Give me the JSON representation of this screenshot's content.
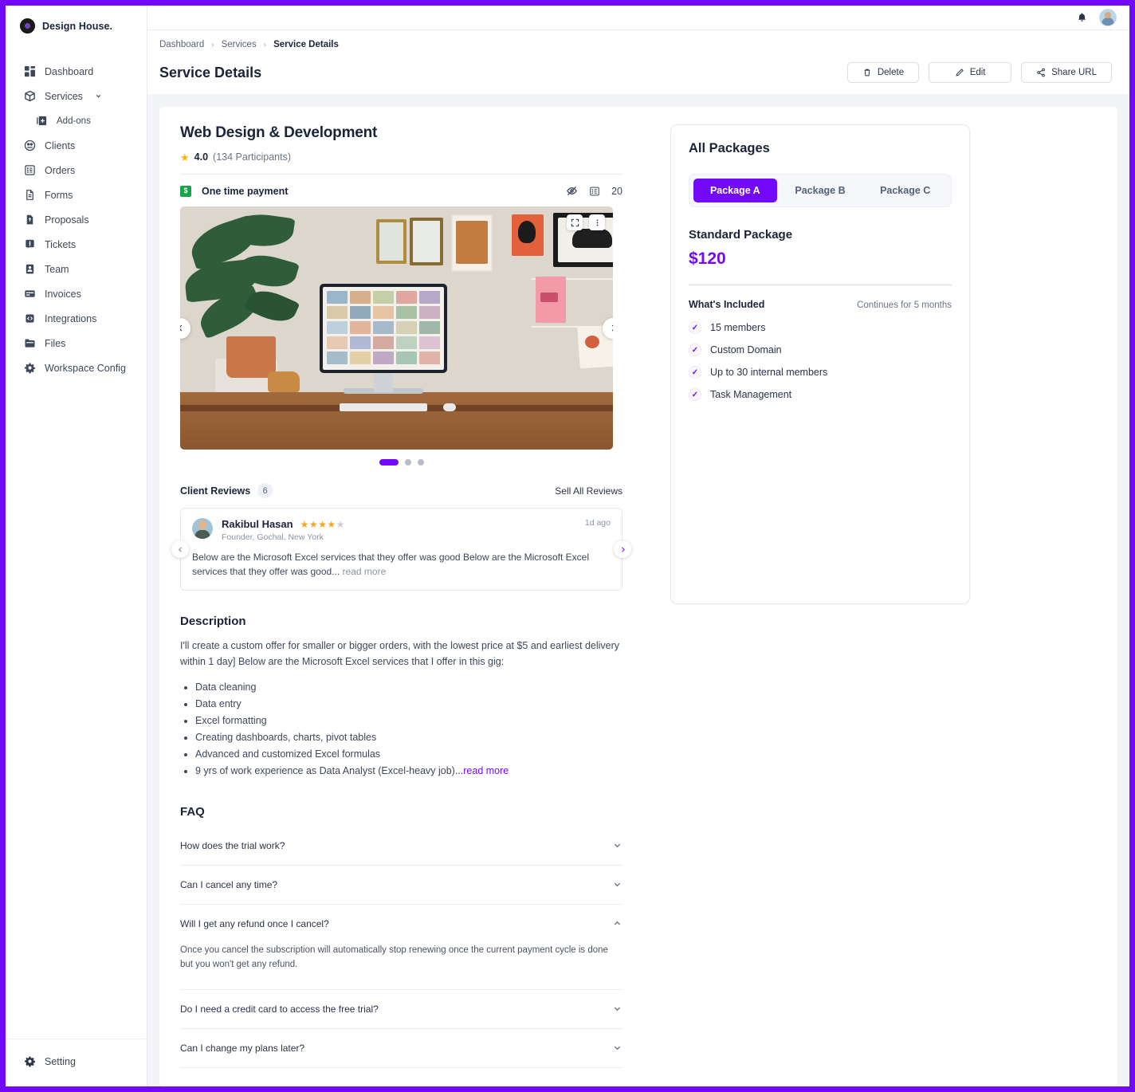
{
  "brand": {
    "name": "Design House.",
    "logo_icon": "brand-logo-icon"
  },
  "sidebar": {
    "items": [
      {
        "label": "Dashboard",
        "icon": "dashboard-icon"
      },
      {
        "label": "Services",
        "icon": "services-box-icon",
        "has_chevron": true
      },
      {
        "label": "Add-ons",
        "icon": "addons-icon",
        "sub": true
      },
      {
        "label": "Clients",
        "icon": "clients-icon"
      },
      {
        "label": "Orders",
        "icon": "orders-icon"
      },
      {
        "label": "Forms",
        "icon": "forms-icon"
      },
      {
        "label": "Proposals",
        "icon": "proposals-icon"
      },
      {
        "label": "Tickets",
        "icon": "tickets-icon"
      },
      {
        "label": "Team",
        "icon": "team-icon"
      },
      {
        "label": "Invoices",
        "icon": "invoices-icon"
      },
      {
        "label": "Integrations",
        "icon": "integrations-icon"
      },
      {
        "label": "Files",
        "icon": "files-icon"
      },
      {
        "label": "Workspace Config",
        "icon": "workspace-config-icon"
      }
    ],
    "bottom": {
      "label": "Setting",
      "icon": "gear-icon"
    }
  },
  "topbar": {
    "bell_icon": "bell-icon",
    "avatar_icon": "avatar"
  },
  "header": {
    "breadcrumb": [
      "Dashboard",
      "Services",
      "Service Details"
    ],
    "separator": "›",
    "title": "Service Details",
    "buttons": [
      {
        "label": "Delete",
        "icon": "trash-icon"
      },
      {
        "label": "Edit",
        "icon": "pencil-icon"
      },
      {
        "label": "Share URL",
        "icon": "share-icon"
      }
    ]
  },
  "service": {
    "title": "Web Design & Development",
    "rating_value": "4.0",
    "rating_count": "(134 Participants)",
    "star_glyph": "★",
    "payment_label": "One time payment",
    "payment_icon_text": "$",
    "visibility_icon": "eye-off-icon",
    "list_icon": "list-icon",
    "list_count": "20"
  },
  "gallery": {
    "expand_icon": "expand-icon",
    "more_icon": "more-vertical-icon",
    "prev_icon": "chevron-left-icon",
    "next_icon": "chevron-right-icon",
    "dots": [
      "active",
      "inactive",
      "inactive"
    ]
  },
  "reviews": {
    "title": "Client Reviews",
    "count": "6",
    "see_all_label": "Sell All Reviews",
    "prev_icon": "chevron-left-icon",
    "next_icon": "chevron-right-icon",
    "item": {
      "name": "Rakibul Hasan",
      "stars_filled": 4,
      "stars_total": 5,
      "when": "1d ago",
      "role": "Founder, Gochal, New York",
      "body": "Below are the Microsoft Excel services that they offer was good Below are the Microsoft Excel services that they offer was good...",
      "read_more": " read more"
    }
  },
  "description": {
    "heading": "Description",
    "paragraph": "I'll create a custom offer for smaller or bigger orders, with the lowest price at $5 and earliest delivery within 1 day] Below are the Microsoft Excel services that I offer in this gig:",
    "bullets": [
      "Data cleaning",
      "Data entry",
      "Excel formatting",
      "Creating dashboards, charts, pivot tables",
      "Advanced and customized Excel formulas",
      "9 yrs of work experience as Data Analyst (Excel-heavy job)..."
    ],
    "read_more": "read more"
  },
  "faq": {
    "heading": "FAQ",
    "items": [
      {
        "question": "How does the trial work?",
        "expanded": false,
        "answer": ""
      },
      {
        "question": "Can I cancel any time?",
        "expanded": false,
        "answer": ""
      },
      {
        "question": "Will I get any refund once I cancel?",
        "expanded": true,
        "answer": "Once you cancel the subscription will automatically stop renewing once the current payment cycle is done but you won't get any refund."
      },
      {
        "question": "Do I need a credit card to access the free trial?",
        "expanded": false,
        "answer": ""
      },
      {
        "question": "Can I change my plans later?",
        "expanded": false,
        "answer": ""
      }
    ]
  },
  "packages": {
    "title": "All Packages",
    "tabs": [
      {
        "label": "Package A",
        "active": true
      },
      {
        "label": "Package B",
        "active": false
      },
      {
        "label": "Package C",
        "active": false
      }
    ],
    "selected_name": "Standard Package",
    "price": "$120",
    "included_label": "What's Included",
    "duration_note": "Continues for 5 months",
    "features": [
      "15 members",
      "Custom Domain",
      "Up to 30 internal members",
      "Task Management"
    ],
    "check_glyph": "✓"
  },
  "colors": {
    "accent": "#7209FA",
    "star": "#F5A623",
    "money_green": "#16A34A",
    "text_dark": "#1B2338",
    "text_muted": "#6B7486",
    "page_bg": "#F2F4F8"
  }
}
